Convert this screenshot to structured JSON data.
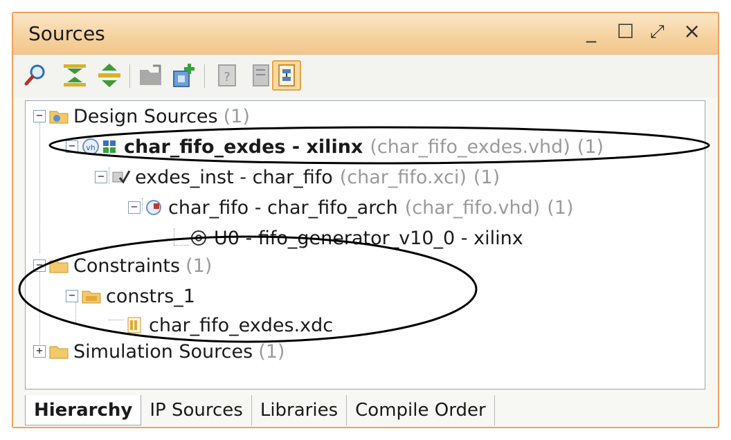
{
  "panel": {
    "title": "Sources",
    "window_buttons": {
      "minimize": "_",
      "maximize": "☐",
      "restore": "⤢",
      "close": "×"
    }
  },
  "toolbar": {
    "buttons": [
      {
        "icon": "search-icon"
      },
      {
        "icon": "collapse-all-icon"
      },
      {
        "icon": "expand-all-icon"
      },
      {
        "icon": "open-folder-icon"
      },
      {
        "icon": "add-sources-icon"
      },
      {
        "icon": "properties-icon"
      },
      {
        "icon": "show-hierarchy-icon",
        "active": true
      }
    ]
  },
  "tree": {
    "design_sources": {
      "label": "Design Sources",
      "count": "(1)"
    },
    "top": {
      "label": "char_fifo_exdes - xilinx",
      "file": "(char_fifo_exdes.vhd)",
      "count": "(1)"
    },
    "exdes_inst": {
      "label": "exdes_inst - char_fifo",
      "file": "(char_fifo.xci)",
      "count": "(1)"
    },
    "char_fifo": {
      "label": "char_fifo - char_fifo_arch",
      "file": "(char_fifo.vhd)",
      "count": "(1)"
    },
    "u0": {
      "label": "U0 - fifo_generator_v10_0 - xilinx"
    },
    "constraints": {
      "label": "Constraints",
      "count": "(1)"
    },
    "constrs_1": {
      "label": "constrs_1"
    },
    "xdc": {
      "label": "char_fifo_exdes.xdc"
    },
    "simulation": {
      "label": "Simulation Sources",
      "count": "(1)"
    }
  },
  "tabs": [
    {
      "label": "Hierarchy",
      "selected": true
    },
    {
      "label": "IP Sources"
    },
    {
      "label": "Libraries"
    },
    {
      "label": "Compile Order"
    }
  ],
  "colors": {
    "title_bar": "#f6d3a2",
    "frame_border": "#f0a25a",
    "annotation": "#000000"
  }
}
